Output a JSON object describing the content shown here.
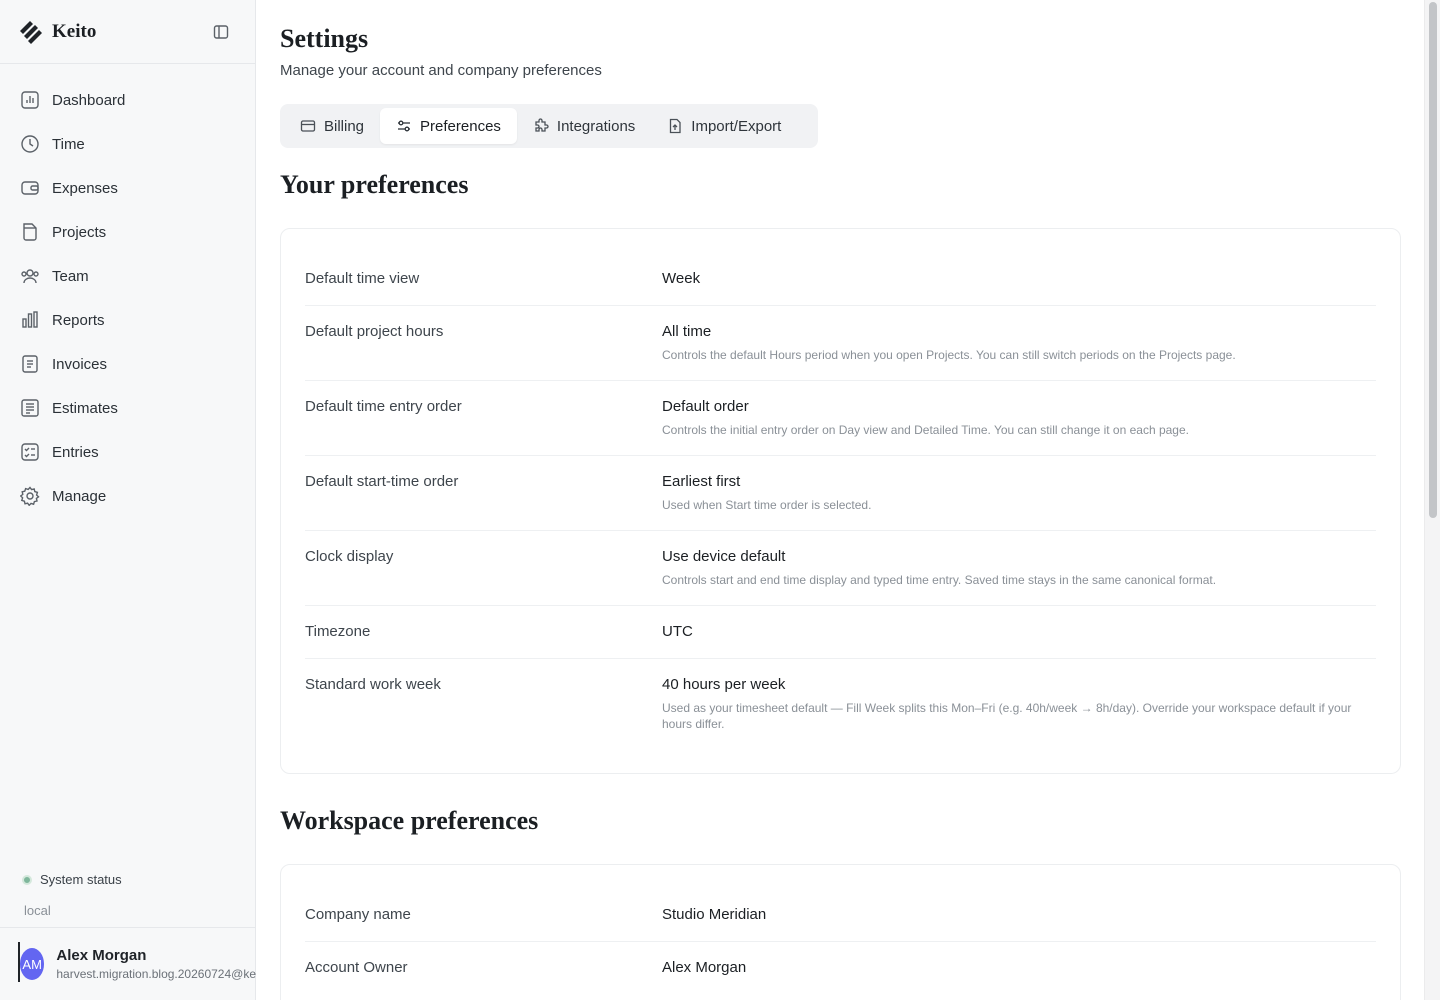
{
  "app": {
    "name": "Keito"
  },
  "sidebar": {
    "items": [
      {
        "label": "Dashboard",
        "icon": "dashboard-icon"
      },
      {
        "label": "Time",
        "icon": "clock-icon"
      },
      {
        "label": "Expenses",
        "icon": "wallet-icon"
      },
      {
        "label": "Projects",
        "icon": "folder-icon"
      },
      {
        "label": "Team",
        "icon": "users-icon"
      },
      {
        "label": "Reports",
        "icon": "bar-chart-icon"
      },
      {
        "label": "Invoices",
        "icon": "invoice-icon"
      },
      {
        "label": "Estimates",
        "icon": "estimate-icon"
      },
      {
        "label": "Entries",
        "icon": "checklist-icon"
      },
      {
        "label": "Manage",
        "icon": "gear-icon"
      }
    ],
    "system_status": "System status",
    "environment": "local",
    "user": {
      "initials": "AM",
      "name": "Alex Morgan",
      "email": "harvest.migration.blog.20260724@ke"
    }
  },
  "header": {
    "title": "Settings",
    "subtitle": "Manage your account and company preferences"
  },
  "tabs": [
    {
      "label": "Billing",
      "icon": "credit-card-icon",
      "active": false
    },
    {
      "label": "Preferences",
      "icon": "sliders-icon",
      "active": true
    },
    {
      "label": "Integrations",
      "icon": "puzzle-icon",
      "active": false
    },
    {
      "label": "Import/Export",
      "icon": "file-upload-icon",
      "active": false
    }
  ],
  "your_preferences": {
    "title": "Your preferences",
    "rows": [
      {
        "label": "Default time view",
        "value": "Week",
        "help": ""
      },
      {
        "label": "Default project hours",
        "value": "All time",
        "help": "Controls the default Hours period when you open Projects. You can still switch periods on the Projects page."
      },
      {
        "label": "Default time entry order",
        "value": "Default order",
        "help": "Controls the initial entry order on Day view and Detailed Time. You can still change it on each page."
      },
      {
        "label": "Default start-time order",
        "value": "Earliest first",
        "help": "Used when Start time order is selected."
      },
      {
        "label": "Clock display",
        "value": "Use device default",
        "help": "Controls start and end time display and typed time entry. Saved time stays in the same canonical format."
      },
      {
        "label": "Timezone",
        "value": "UTC",
        "help": ""
      },
      {
        "label": "Standard work week",
        "value": "40 hours per week",
        "help": "Used as your timesheet default — Fill Week splits this Mon–Fri (e.g. 40h/week → 8h/day). Override your workspace default if your hours differ."
      }
    ]
  },
  "workspace_preferences": {
    "title": "Workspace preferences",
    "rows": [
      {
        "label": "Company name",
        "value": "Studio Meridian",
        "help": ""
      },
      {
        "label": "Account Owner",
        "value": "Alex Morgan",
        "help": ""
      }
    ]
  },
  "colors": {
    "accent": "#6366f1",
    "status_ok": "#7fb79c"
  }
}
